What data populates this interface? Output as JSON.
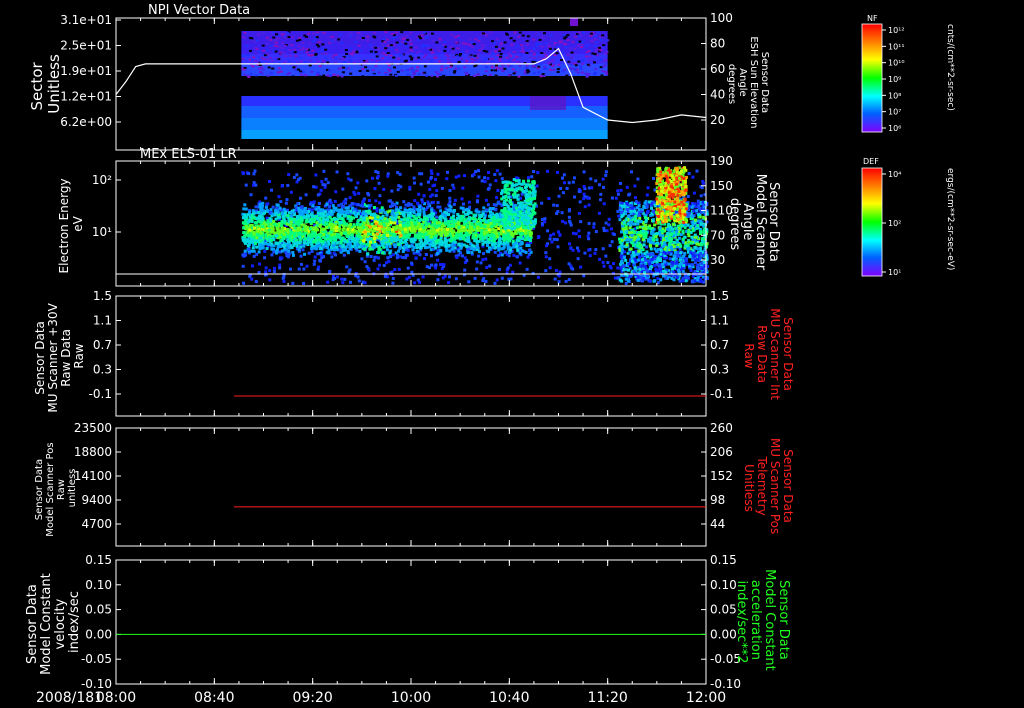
{
  "date_label": "2008/181",
  "time_ticks": [
    "08:00",
    "08:40",
    "09:20",
    "10:00",
    "10:40",
    "11:20",
    "12:00"
  ],
  "chart_data": [
    {
      "type": "heatmap",
      "title": "NPI Vector Data",
      "ylabel_left": [
        "Sector",
        "Unitless"
      ],
      "yticks_left": [
        "3.1e+01",
        "2.5e+01",
        "1.9e+01",
        "1.2e+01",
        "6.2e+00"
      ],
      "ylabel_right": [
        "Sensor Data",
        "ESH Sun Elevation",
        "Angle",
        "degrees"
      ],
      "yticks_right": [
        "100",
        "80",
        "60",
        "40",
        "20"
      ],
      "ylim_right": [
        0,
        100
      ],
      "colorbar": {
        "label": "NF",
        "units": "cnts/(cm**2-sr-sec)",
        "ticks": [
          "10¹²",
          "10¹¹",
          "10¹⁰",
          "10⁹",
          "10⁸",
          "10⁷",
          "10⁶"
        ],
        "colors": [
          "#ff0000",
          "#ff8000",
          "#ffff00",
          "#00ff00",
          "#00ffff",
          "#0060ff",
          "#8000ff"
        ]
      },
      "data_coverage": {
        "start": "08:51",
        "end": "11:20",
        "gap_sectors": [
          "1.6e+01",
          "1.3e+01"
        ]
      },
      "line_series": {
        "name": "ESH Sun Elevation Angle",
        "color": "#ffffff",
        "x": [
          "08:00",
          "08:04",
          "08:08",
          "08:12",
          "08:20",
          "08:40",
          "09:20",
          "10:00",
          "10:40",
          "10:50",
          "10:55",
          "11:00",
          "11:05",
          "11:10",
          "11:20",
          "11:30",
          "11:40",
          "11:45",
          "11:50",
          "12:00"
        ],
        "y": [
          40,
          50,
          62,
          64,
          64,
          64,
          64,
          64,
          64,
          64,
          68,
          76,
          56,
          30,
          20,
          18,
          20,
          22,
          24,
          22
        ]
      }
    },
    {
      "type": "heatmap",
      "title": "MEx ELS-01 LR",
      "ylabel_left": [
        "Electron Energy",
        "eV"
      ],
      "yticks_left": [
        "10²",
        "10¹"
      ],
      "ylabel_right": [
        "Sensor Data",
        "Model Scanner",
        "Angle",
        "degrees"
      ],
      "yticks_right": [
        "190",
        "150",
        "110",
        "70",
        "30"
      ],
      "ylim_right": [
        0,
        190
      ],
      "colorbar": {
        "label": "DEF",
        "units": "ergs/(cm**2-sr-sec-eV)",
        "ticks": [
          "10⁴",
          "10²",
          "10¹"
        ],
        "colors": [
          "#ff0000",
          "#ff8000",
          "#ffff00",
          "#00ff00",
          "#00ffff",
          "#0060ff",
          "#8000ff"
        ]
      },
      "data_coverage": {
        "start": "08:51",
        "end": "12:00"
      },
      "line_series": {
        "name": "Model Scanner Angle",
        "color": "#ffffff",
        "x": [
          "08:00",
          "12:00"
        ],
        "y": [
          20,
          20
        ]
      }
    },
    {
      "type": "line",
      "ylabel_left": [
        "Sensor Data",
        "MU Scanner +30V",
        "Raw Data",
        "Raw"
      ],
      "yticks_left": [
        "1.5",
        "1.1",
        "0.7",
        "0.3",
        "-0.1"
      ],
      "ylabel_right": [
        "Sensor Data",
        "MU Scanner Int",
        "Raw Data",
        "Raw"
      ],
      "yticks_right": [
        "1.5",
        "1.1",
        "0.7",
        "0.3",
        "-0.1"
      ],
      "ylim": [
        -0.3,
        1.5
      ],
      "right_label_color": "#ff2020",
      "series": [
        {
          "name": "MU Scanner Int",
          "color": "#ff2020",
          "x": [
            "08:48",
            "12:00"
          ],
          "y": [
            0.0,
            0.0
          ]
        }
      ]
    },
    {
      "type": "line",
      "ylabel_left": [
        "Sensor Data",
        "Model Scanner Pos",
        "Raw",
        "unitless"
      ],
      "yticks_left": [
        "23500",
        "18800",
        "14100",
        "9400",
        "4700"
      ],
      "ylabel_right": [
        "Sensor Data",
        "MU Scanner Pos",
        "Telemetry",
        "Unitless"
      ],
      "yticks_right": [
        "260",
        "206",
        "152",
        "98",
        "44"
      ],
      "ylim": [
        0,
        23500
      ],
      "right_label_color": "#ff2020",
      "series": [
        {
          "name": "MU Scanner Pos",
          "color": "#ff2020",
          "x": [
            "08:48",
            "12:00"
          ],
          "y": [
            7800,
            7800
          ]
        }
      ]
    },
    {
      "type": "line",
      "ylabel_left": [
        "Sensor Data",
        "Model Constant",
        "velocity",
        "index/sec"
      ],
      "yticks_left": [
        "0.15",
        "0.10",
        "0.05",
        "0.00",
        "-0.05",
        "-0.10"
      ],
      "ylabel_right": [
        "Sensor Data",
        "Model Constant",
        "acceleration",
        "index/sec**2"
      ],
      "yticks_right": [
        "0.15",
        "0.10",
        "0.05",
        "0.00",
        "-0.05",
        "-0.10"
      ],
      "ylim": [
        -0.1,
        0.15
      ],
      "right_label_color": "#20ff20",
      "series": [
        {
          "name": "Model Constant acceleration",
          "color": "#20ff20",
          "x": [
            "08:00",
            "12:00"
          ],
          "y": [
            0.0,
            0.0
          ]
        }
      ]
    }
  ]
}
